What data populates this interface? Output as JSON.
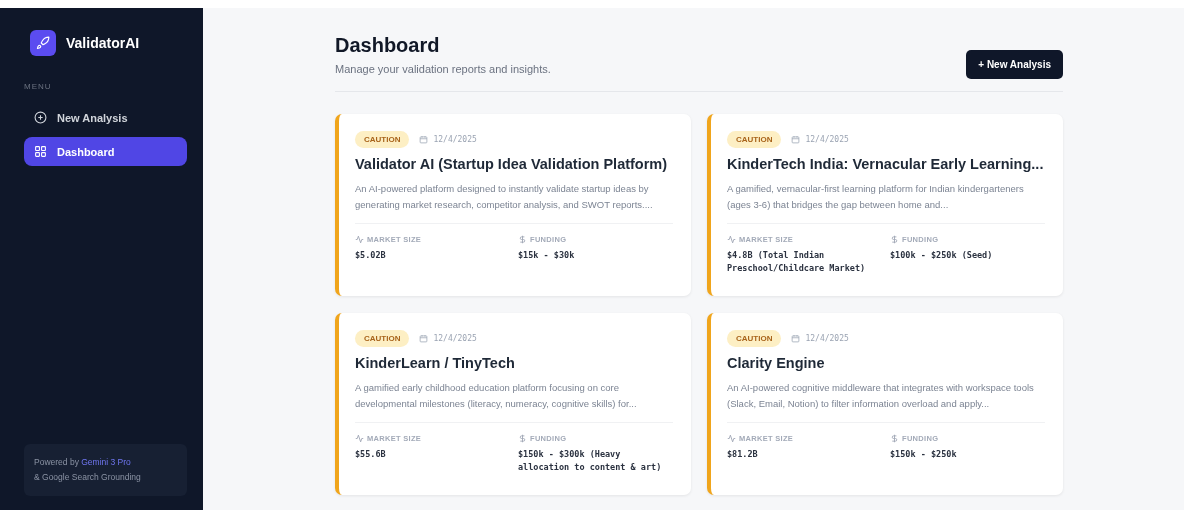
{
  "sidebar": {
    "brand": "ValidatorAI",
    "menu_label": "MENU",
    "items": [
      {
        "label": "New Analysis",
        "kind": "add",
        "selected": false
      },
      {
        "label": "Dashboard",
        "kind": "grid",
        "selected": true
      }
    ],
    "footer": {
      "prefix": "Powered by",
      "model": "Gemini 3 Pro",
      "suffix": "& Google Search Grounding"
    }
  },
  "header": {
    "title": "Dashboard",
    "subtitle": "Manage your validation reports and insights.",
    "button": "+ New Analysis"
  },
  "cards": [
    {
      "status": "CAUTION",
      "date": "12/4/2025",
      "title": "Validator AI (Startup Idea Validation Platform)",
      "description": "An AI-powered platform designed to instantly validate startup ideas by generating market research, competitor analysis, and SWOT reports....",
      "market_label": "MARKET SIZE",
      "market": "$5.02B",
      "funding_label": "FUNDING",
      "funding": "$15k - $30k"
    },
    {
      "status": "CAUTION",
      "date": "12/4/2025",
      "title": "KinderTech India: Vernacular Early Learning...",
      "description": "A gamified, vernacular-first learning platform for Indian kindergarteners (ages 3-6) that bridges the gap between home and...",
      "market_label": "MARKET SIZE",
      "market": "$4.8B (Total Indian Preschool/Childcare Market)",
      "funding_label": "FUNDING",
      "funding": "$100k - $250k (Seed)"
    },
    {
      "status": "CAUTION",
      "date": "12/4/2025",
      "title": "KinderLearn / TinyTech",
      "description": "A gamified early childhood education platform focusing on core developmental milestones (literacy, numeracy, cognitive skills) for...",
      "market_label": "MARKET SIZE",
      "market": "$55.6B",
      "funding_label": "FUNDING",
      "funding": "$150k - $300k (Heavy allocation to content & art)"
    },
    {
      "status": "CAUTION",
      "date": "12/4/2025",
      "title": "Clarity Engine",
      "description": "An AI-powered cognitive middleware that integrates with workspace tools (Slack, Email, Notion) to filter information overload and apply...",
      "market_label": "MARKET SIZE",
      "market": "$81.2B",
      "funding_label": "FUNDING",
      "funding": "$150k - $250k"
    }
  ]
}
